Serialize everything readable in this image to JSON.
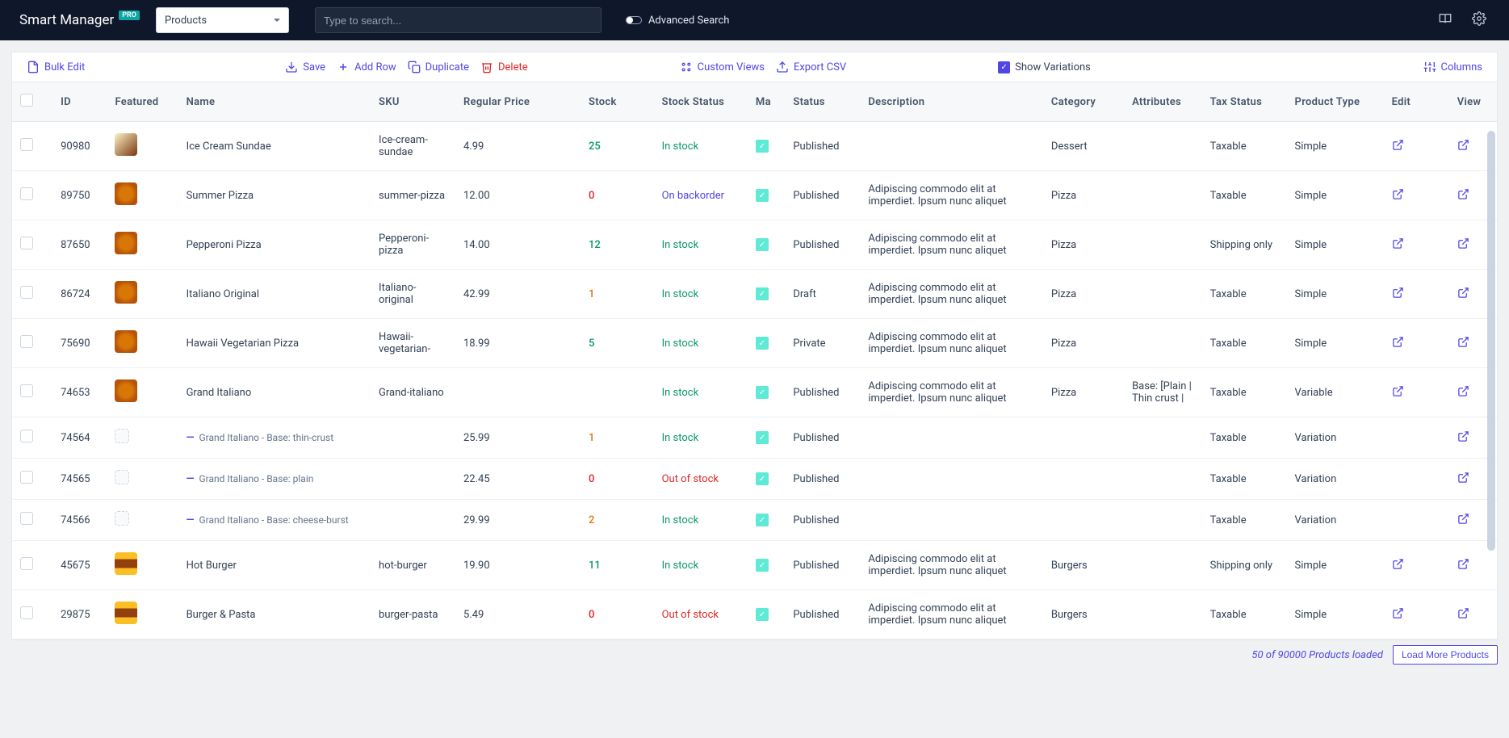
{
  "header": {
    "brand": "Smart Manager",
    "badge": "PRO",
    "entity": "Products",
    "search_placeholder": "Type to search...",
    "advanced_search": "Advanced Search"
  },
  "toolbar": {
    "bulk_edit": "Bulk Edit",
    "save": "Save",
    "add_row": "Add Row",
    "duplicate": "Duplicate",
    "delete": "Delete",
    "custom_views": "Custom Views",
    "export_csv": "Export CSV",
    "show_variations": "Show Variations",
    "columns": "Columns"
  },
  "columns": {
    "id": "ID",
    "featured": "Featured",
    "name": "Name",
    "sku": "SKU",
    "regular_price": "Regular Price",
    "stock": "Stock",
    "stock_status": "Stock Status",
    "ma": "Ma",
    "status": "Status",
    "description": "Description",
    "category": "Category",
    "attributes": "Attributes",
    "tax_status": "Tax Status",
    "product_type": "Product Type",
    "edit": "Edit",
    "view": "View"
  },
  "rows": [
    {
      "id": "90980",
      "thumb": "dessert",
      "name": "Ice Cream Sundae",
      "sku": "Ice-cream-sundae",
      "price": "4.99",
      "stock": "25",
      "stock_cls": "stock-green",
      "ss": "In stock",
      "ss_cls": "ss-instock",
      "status": "Published",
      "desc": "",
      "cat": "Dessert",
      "attr": "",
      "tax": "Taxable",
      "ptype": "Simple",
      "variation": false,
      "edit": true
    },
    {
      "id": "89750",
      "thumb": "pizza",
      "name": "Summer Pizza",
      "sku": "summer-pizza",
      "price": "12.00",
      "stock": "0",
      "stock_cls": "stock-red",
      "ss": "On backorder",
      "ss_cls": "ss-backorder",
      "status": "Published",
      "desc": "Adipiscing commodo elit at imperdiet. Ipsum nunc aliquet",
      "cat": "Pizza",
      "attr": "",
      "tax": "Taxable",
      "ptype": "Simple",
      "variation": false,
      "edit": true
    },
    {
      "id": "87650",
      "thumb": "pizza",
      "name": "Pepperoni Pizza",
      "sku": "Pepperoni-pizza",
      "price": "14.00",
      "stock": "12",
      "stock_cls": "stock-green",
      "ss": "In stock",
      "ss_cls": "ss-instock",
      "status": "Published",
      "desc": "Adipiscing commodo elit at imperdiet. Ipsum nunc aliquet",
      "cat": "Pizza",
      "attr": "",
      "tax": "Shipping only",
      "ptype": "Simple",
      "variation": false,
      "edit": true
    },
    {
      "id": "86724",
      "thumb": "pizza",
      "name": "Italiano Original",
      "sku": "Italiano-original",
      "price": "42.99",
      "stock": "1",
      "stock_cls": "stock-orange",
      "ss": "In stock",
      "ss_cls": "ss-instock",
      "status": "Draft",
      "desc": "Adipiscing commodo elit at imperdiet. Ipsum nunc aliquet",
      "cat": "Pizza",
      "attr": "",
      "tax": "Taxable",
      "ptype": "Simple",
      "variation": false,
      "edit": true
    },
    {
      "id": "75690",
      "thumb": "pizza",
      "name": "Hawaii Vegetarian Pizza",
      "sku": "Hawaii-vegetarian-",
      "price": "18.99",
      "stock": "5",
      "stock_cls": "stock-green",
      "ss": "In stock",
      "ss_cls": "ss-instock",
      "status": "Private",
      "desc": "Adipiscing commodo elit at imperdiet. Ipsum nunc aliquet",
      "cat": "Pizza",
      "attr": "",
      "tax": "Taxable",
      "ptype": "Simple",
      "variation": false,
      "edit": true
    },
    {
      "id": "74653",
      "thumb": "pizza",
      "name": "Grand Italiano",
      "sku": "Grand-italiano",
      "price": "",
      "stock": "",
      "stock_cls": "",
      "ss": "In stock",
      "ss_cls": "ss-instock",
      "status": "Published",
      "desc": "Adipiscing commodo elit at imperdiet. Ipsum nunc aliquet",
      "cat": "Pizza",
      "attr": "Base: [Plain | Thin crust |",
      "tax": "Taxable",
      "ptype": "Variable",
      "variation": false,
      "edit": true
    },
    {
      "id": "74564",
      "thumb": "variation",
      "name": "Grand Italiano - Base: thin-crust",
      "sku": "",
      "price": "25.99",
      "stock": "1",
      "stock_cls": "stock-orange",
      "ss": "In stock",
      "ss_cls": "ss-instock",
      "status": "Published",
      "desc": "",
      "cat": "",
      "attr": "",
      "tax": "Taxable",
      "ptype": "Variation",
      "variation": true,
      "edit": false
    },
    {
      "id": "74565",
      "thumb": "variation",
      "name": "Grand Italiano - Base: plain",
      "sku": "",
      "price": "22.45",
      "stock": "0",
      "stock_cls": "stock-red",
      "ss": "Out of stock",
      "ss_cls": "ss-outstock",
      "status": "Published",
      "desc": "",
      "cat": "",
      "attr": "",
      "tax": "Taxable",
      "ptype": "Variation",
      "variation": true,
      "edit": false
    },
    {
      "id": "74566",
      "thumb": "variation",
      "name": "Grand Italiano - Base: cheese-burst",
      "sku": "",
      "price": "29.99",
      "stock": "2",
      "stock_cls": "stock-orange",
      "ss": "In stock",
      "ss_cls": "ss-instock",
      "status": "Published",
      "desc": "",
      "cat": "",
      "attr": "",
      "tax": "Taxable",
      "ptype": "Variation",
      "variation": true,
      "edit": false
    },
    {
      "id": "45675",
      "thumb": "burger",
      "name": "Hot Burger",
      "sku": "hot-burger",
      "price": "19.90",
      "stock": "11",
      "stock_cls": "stock-green",
      "ss": "In stock",
      "ss_cls": "ss-instock",
      "status": "Published",
      "desc": "Adipiscing commodo elit at imperdiet. Ipsum nunc aliquet",
      "cat": "Burgers",
      "attr": "",
      "tax": "Shipping only",
      "ptype": "Simple",
      "variation": false,
      "edit": true
    },
    {
      "id": "29875",
      "thumb": "burger",
      "name": "Burger & Pasta",
      "sku": "burger-pasta",
      "price": "5.49",
      "stock": "0",
      "stock_cls": "stock-red",
      "ss": "Out of stock",
      "ss_cls": "ss-outstock",
      "status": "Published",
      "desc": "Adipiscing commodo elit at imperdiet. Ipsum nunc aliquet",
      "cat": "Burgers",
      "attr": "",
      "tax": "Taxable",
      "ptype": "Simple",
      "variation": false,
      "edit": true
    }
  ],
  "footer": {
    "loaded": "50 of 90000 Products loaded",
    "load_more": "Load More Products"
  }
}
